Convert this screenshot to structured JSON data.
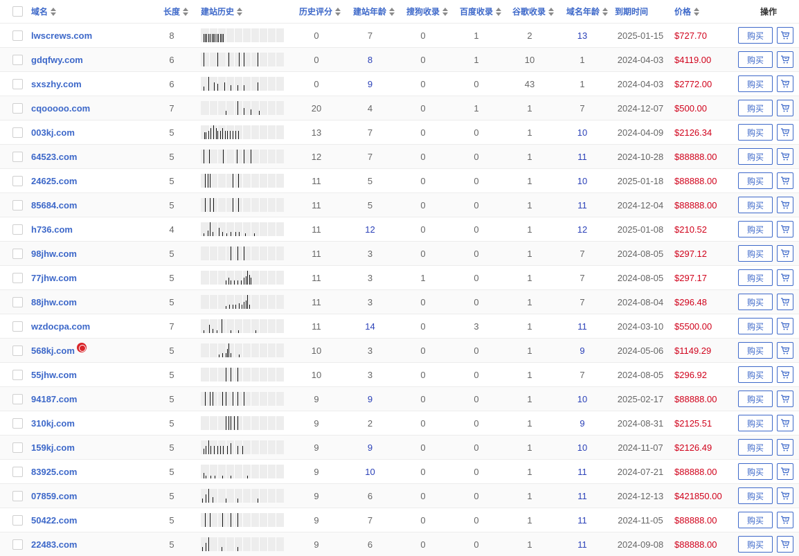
{
  "header": {
    "domain": "域名",
    "length": "长度",
    "history": "建站历史",
    "score": "历史评分",
    "site_age": "建站年龄",
    "sogou": "搜狗收录",
    "baidu": "百度收录",
    "google": "谷歌收录",
    "domain_age": "域名年龄",
    "expiry": "到期时间",
    "price": "价格",
    "ops": "操作"
  },
  "buy_label": "购买",
  "colors": {
    "link": "#3d68c9",
    "price": "#d0021b",
    "highlight_num": "#2b41b8"
  },
  "rows": [
    {
      "domain": "lwscrews.com",
      "length": "8",
      "score": "0",
      "site_age": "7",
      "sogou": "0",
      "baidu": "1",
      "google": "2",
      "domain_age": "13",
      "expiry": "2025-01-15",
      "price": "$727.70",
      "hist": [
        [
          0.03,
          0.6
        ],
        [
          0.05,
          0.6
        ],
        [
          0.07,
          0.6
        ],
        [
          0.09,
          0.6
        ],
        [
          0.11,
          0.6
        ],
        [
          0.13,
          0.6
        ],
        [
          0.15,
          0.6
        ],
        [
          0.17,
          0.6
        ],
        [
          0.19,
          0.6
        ],
        [
          0.21,
          0.6
        ],
        [
          0.23,
          0.6
        ],
        [
          0.25,
          0.6
        ],
        [
          0.27,
          0.6
        ]
      ],
      "site_age_blue": false,
      "domain_age_blue": true
    },
    {
      "domain": "gdqfwy.com",
      "length": "6",
      "score": "0",
      "site_age": "8",
      "sogou": "0",
      "baidu": "1",
      "google": "10",
      "domain_age": "1",
      "expiry": "2024-04-03",
      "price": "$4119.00",
      "hist": [
        [
          0.03,
          1
        ],
        [
          0.2,
          1
        ],
        [
          0.33,
          1
        ],
        [
          0.46,
          1
        ],
        [
          0.52,
          1
        ],
        [
          0.68,
          1
        ]
      ],
      "site_age_blue": true,
      "domain_age_blue": false
    },
    {
      "domain": "sxszhy.com",
      "length": "6",
      "score": "0",
      "site_age": "9",
      "sogou": "0",
      "baidu": "0",
      "google": "43",
      "domain_age": "1",
      "expiry": "2024-04-03",
      "price": "$2772.00",
      "hist": [
        [
          0.03,
          0.3
        ],
        [
          0.09,
          1
        ],
        [
          0.16,
          0.6
        ],
        [
          0.2,
          0.5
        ],
        [
          0.28,
          0.6
        ],
        [
          0.36,
          0.4
        ],
        [
          0.44,
          0.4
        ],
        [
          0.52,
          0.4
        ],
        [
          0.68,
          0.6
        ]
      ],
      "site_age_blue": true,
      "domain_age_blue": false
    },
    {
      "domain": "cqooooo.com",
      "length": "7",
      "score": "20",
      "site_age": "4",
      "sogou": "0",
      "baidu": "1",
      "google": "1",
      "domain_age": "7",
      "expiry": "2024-12-07",
      "price": "$500.00",
      "hist": [
        [
          0.3,
          0.3
        ],
        [
          0.44,
          1
        ],
        [
          0.52,
          0.5
        ],
        [
          0.6,
          0.4
        ],
        [
          0.7,
          0.3
        ]
      ],
      "site_age_blue": false,
      "domain_age_blue": false
    },
    {
      "domain": "003kj.com",
      "length": "5",
      "score": "13",
      "site_age": "7",
      "sogou": "0",
      "baidu": "0",
      "google": "1",
      "domain_age": "10",
      "expiry": "2024-04-09",
      "price": "$2126.34",
      "hist": [
        [
          0.04,
          0.5
        ],
        [
          0.06,
          0.5
        ],
        [
          0.09,
          0.6
        ],
        [
          0.12,
          0.8
        ],
        [
          0.15,
          1
        ],
        [
          0.18,
          0.8
        ],
        [
          0.2,
          0.6
        ],
        [
          0.23,
          0.6
        ],
        [
          0.26,
          0.8
        ],
        [
          0.29,
          0.6
        ],
        [
          0.32,
          0.6
        ],
        [
          0.35,
          0.6
        ],
        [
          0.38,
          0.6
        ],
        [
          0.42,
          0.6
        ],
        [
          0.45,
          0.6
        ]
      ],
      "site_age_blue": false,
      "domain_age_blue": true
    },
    {
      "domain": "64523.com",
      "length": "5",
      "score": "12",
      "site_age": "7",
      "sogou": "0",
      "baidu": "0",
      "google": "1",
      "domain_age": "11",
      "expiry": "2024-10-28",
      "price": "$88888.00",
      "hist": [
        [
          0.03,
          1
        ],
        [
          0.1,
          1
        ],
        [
          0.27,
          1
        ],
        [
          0.43,
          1
        ],
        [
          0.52,
          1
        ],
        [
          0.6,
          1
        ]
      ],
      "site_age_blue": false,
      "domain_age_blue": true
    },
    {
      "domain": "24625.com",
      "length": "5",
      "score": "11",
      "site_age": "5",
      "sogou": "0",
      "baidu": "0",
      "google": "1",
      "domain_age": "10",
      "expiry": "2025-01-18",
      "price": "$88888.00",
      "hist": [
        [
          0.05,
          1
        ],
        [
          0.08,
          1
        ],
        [
          0.11,
          1
        ],
        [
          0.38,
          1
        ],
        [
          0.45,
          1
        ]
      ],
      "site_age_blue": false,
      "domain_age_blue": true
    },
    {
      "domain": "85684.com",
      "length": "5",
      "score": "11",
      "site_age": "5",
      "sogou": "0",
      "baidu": "0",
      "google": "1",
      "domain_age": "11",
      "expiry": "2024-12-04",
      "price": "$88888.00",
      "hist": [
        [
          0.05,
          1
        ],
        [
          0.11,
          1
        ],
        [
          0.15,
          1
        ],
        [
          0.38,
          1
        ],
        [
          0.45,
          1
        ]
      ],
      "site_age_blue": false,
      "domain_age_blue": true
    },
    {
      "domain": "h736.com",
      "length": "4",
      "score": "11",
      "site_age": "12",
      "sogou": "0",
      "baidu": "0",
      "google": "1",
      "domain_age": "12",
      "expiry": "2025-01-08",
      "price": "$210.52",
      "hist": [
        [
          0.03,
          0.2
        ],
        [
          0.08,
          0.4
        ],
        [
          0.11,
          1
        ],
        [
          0.14,
          0.3
        ],
        [
          0.22,
          0.6
        ],
        [
          0.26,
          0.3
        ],
        [
          0.31,
          0.2
        ],
        [
          0.36,
          0.3
        ],
        [
          0.42,
          0.3
        ],
        [
          0.46,
          0.3
        ],
        [
          0.53,
          0.2
        ],
        [
          0.64,
          0.2
        ]
      ],
      "site_age_blue": true,
      "domain_age_blue": true
    },
    {
      "domain": "98jhw.com",
      "length": "5",
      "score": "11",
      "site_age": "3",
      "sogou": "0",
      "baidu": "0",
      "google": "1",
      "domain_age": "7",
      "expiry": "2024-08-05",
      "price": "$297.12",
      "hist": [
        [
          0.36,
          1
        ],
        [
          0.44,
          1
        ],
        [
          0.52,
          1
        ]
      ],
      "site_age_blue": false,
      "domain_age_blue": false
    },
    {
      "domain": "77jhw.com",
      "length": "5",
      "score": "11",
      "site_age": "3",
      "sogou": "1",
      "baidu": "0",
      "google": "1",
      "domain_age": "7",
      "expiry": "2024-08-05",
      "price": "$297.17",
      "hist": [
        [
          0.3,
          0.3
        ],
        [
          0.33,
          0.5
        ],
        [
          0.36,
          0.3
        ],
        [
          0.4,
          0.3
        ],
        [
          0.44,
          0.3
        ],
        [
          0.48,
          0.3
        ],
        [
          0.52,
          0.5
        ],
        [
          0.54,
          0.6
        ],
        [
          0.56,
          1
        ],
        [
          0.58,
          0.7
        ],
        [
          0.6,
          0.5
        ]
      ],
      "site_age_blue": false,
      "domain_age_blue": false
    },
    {
      "domain": "88jhw.com",
      "length": "5",
      "score": "11",
      "site_age": "3",
      "sogou": "0",
      "baidu": "0",
      "google": "1",
      "domain_age": "7",
      "expiry": "2024-08-04",
      "price": "$296.48",
      "hist": [
        [
          0.3,
          0.2
        ],
        [
          0.34,
          0.3
        ],
        [
          0.38,
          0.3
        ],
        [
          0.42,
          0.3
        ],
        [
          0.46,
          0.4
        ],
        [
          0.49,
          0.3
        ],
        [
          0.52,
          0.5
        ],
        [
          0.54,
          0.6
        ],
        [
          0.56,
          1
        ],
        [
          0.58,
          0.3
        ]
      ],
      "site_age_blue": false,
      "domain_age_blue": false
    },
    {
      "domain": "wzdocpa.com",
      "length": "7",
      "score": "11",
      "site_age": "14",
      "sogou": "0",
      "baidu": "3",
      "google": "1",
      "domain_age": "11",
      "expiry": "2024-03-10",
      "price": "$5500.00",
      "hist": [
        [
          0.03,
          0.2
        ],
        [
          0.1,
          0.6
        ],
        [
          0.14,
          0.3
        ],
        [
          0.19,
          0.2
        ],
        [
          0.25,
          1
        ],
        [
          0.36,
          0.2
        ],
        [
          0.45,
          0.2
        ],
        [
          0.66,
          0.2
        ]
      ],
      "site_age_blue": true,
      "domain_age_blue": true
    },
    {
      "domain": "568kj.com",
      "length": "5",
      "score": "10",
      "site_age": "3",
      "sogou": "0",
      "baidu": "0",
      "google": "1",
      "domain_age": "9",
      "expiry": "2024-05-06",
      "price": "$1149.29",
      "icon": true,
      "hist": [
        [
          0.22,
          0.2
        ],
        [
          0.26,
          0.3
        ],
        [
          0.3,
          0.3
        ],
        [
          0.32,
          0.6
        ],
        [
          0.33,
          1
        ],
        [
          0.36,
          0.3
        ],
        [
          0.46,
          0.2
        ]
      ],
      "site_age_blue": false,
      "domain_age_blue": true
    },
    {
      "domain": "55jhw.com",
      "length": "5",
      "score": "10",
      "site_age": "3",
      "sogou": "0",
      "baidu": "0",
      "google": "1",
      "domain_age": "7",
      "expiry": "2024-08-05",
      "price": "$296.92",
      "hist": [
        [
          0.3,
          1
        ],
        [
          0.36,
          1
        ],
        [
          0.44,
          1
        ]
      ],
      "site_age_blue": false,
      "domain_age_blue": false
    },
    {
      "domain": "94187.com",
      "length": "5",
      "score": "9",
      "site_age": "9",
      "sogou": "0",
      "baidu": "0",
      "google": "1",
      "domain_age": "10",
      "expiry": "2025-02-17",
      "price": "$88888.00",
      "hist": [
        [
          0.05,
          1
        ],
        [
          0.11,
          1
        ],
        [
          0.14,
          1
        ],
        [
          0.26,
          1
        ],
        [
          0.3,
          1
        ],
        [
          0.38,
          1
        ],
        [
          0.44,
          1
        ],
        [
          0.52,
          1
        ]
      ],
      "site_age_blue": true,
      "domain_age_blue": true
    },
    {
      "domain": "310kj.com",
      "length": "5",
      "score": "9",
      "site_age": "2",
      "sogou": "0",
      "baidu": "0",
      "google": "1",
      "domain_age": "9",
      "expiry": "2024-08-31",
      "price": "$2125.51",
      "hist": [
        [
          0.3,
          1
        ],
        [
          0.33,
          1
        ],
        [
          0.36,
          1
        ],
        [
          0.4,
          1
        ],
        [
          0.44,
          1
        ]
      ],
      "site_age_blue": false,
      "domain_age_blue": true
    },
    {
      "domain": "159kj.com",
      "length": "5",
      "score": "9",
      "site_age": "9",
      "sogou": "0",
      "baidu": "0",
      "google": "1",
      "domain_age": "10",
      "expiry": "2024-11-07",
      "price": "$2126.49",
      "hist": [
        [
          0.03,
          0.4
        ],
        [
          0.06,
          0.6
        ],
        [
          0.09,
          1
        ],
        [
          0.12,
          0.6
        ],
        [
          0.16,
          0.6
        ],
        [
          0.2,
          0.6
        ],
        [
          0.23,
          0.6
        ],
        [
          0.27,
          0.6
        ],
        [
          0.32,
          0.6
        ],
        [
          0.36,
          0.8
        ],
        [
          0.44,
          0.6
        ],
        [
          0.5,
          0.6
        ]
      ],
      "site_age_blue": true,
      "domain_age_blue": true
    },
    {
      "domain": "83925.com",
      "length": "5",
      "score": "9",
      "site_age": "10",
      "sogou": "0",
      "baidu": "0",
      "google": "1",
      "domain_age": "11",
      "expiry": "2024-07-21",
      "price": "$88888.00",
      "hist": [
        [
          0.03,
          0.4
        ],
        [
          0.06,
          0.2
        ],
        [
          0.12,
          0.2
        ],
        [
          0.17,
          0.2
        ],
        [
          0.26,
          0.2
        ],
        [
          0.36,
          0.2
        ],
        [
          0.56,
          0.2
        ]
      ],
      "site_age_blue": true,
      "domain_age_blue": true
    },
    {
      "domain": "07859.com",
      "length": "5",
      "score": "9",
      "site_age": "6",
      "sogou": "0",
      "baidu": "0",
      "google": "1",
      "domain_age": "11",
      "expiry": "2024-12-13",
      "price": "$421850.00",
      "hist": [
        [
          0.02,
          0.3
        ],
        [
          0.06,
          0.6
        ],
        [
          0.09,
          1
        ],
        [
          0.14,
          0.4
        ],
        [
          0.3,
          0.3
        ],
        [
          0.44,
          0.3
        ],
        [
          0.68,
          0.3
        ]
      ],
      "site_age_blue": false,
      "domain_age_blue": true
    },
    {
      "domain": "50422.com",
      "length": "5",
      "score": "9",
      "site_age": "7",
      "sogou": "0",
      "baidu": "0",
      "google": "1",
      "domain_age": "11",
      "expiry": "2024-11-05",
      "price": "$88888.00",
      "hist": [
        [
          0.05,
          1
        ],
        [
          0.11,
          1
        ],
        [
          0.26,
          1
        ],
        [
          0.36,
          1
        ],
        [
          0.44,
          1
        ]
      ],
      "site_age_blue": false,
      "domain_age_blue": true
    },
    {
      "domain": "22483.com",
      "length": "5",
      "score": "9",
      "site_age": "6",
      "sogou": "0",
      "baidu": "0",
      "google": "1",
      "domain_age": "11",
      "expiry": "2024-09-08",
      "price": "$88888.00",
      "hist": [
        [
          0.02,
          0.3
        ],
        [
          0.06,
          0.6
        ],
        [
          0.09,
          1
        ],
        [
          0.25,
          0.3
        ],
        [
          0.44,
          0.3
        ]
      ],
      "site_age_blue": false,
      "domain_age_blue": true
    }
  ]
}
